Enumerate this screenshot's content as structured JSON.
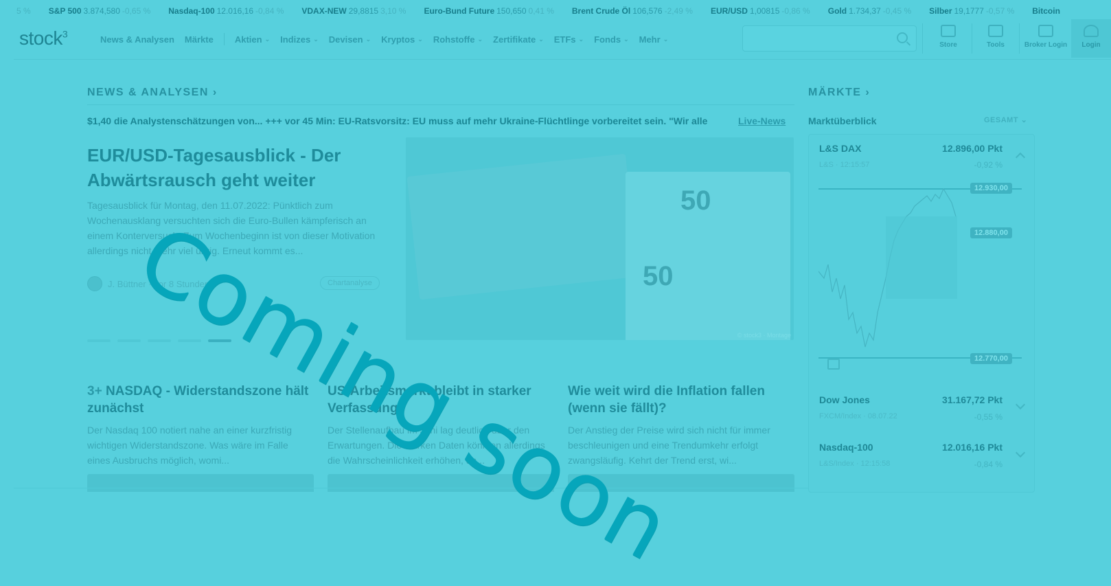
{
  "ticker": [
    {
      "name": "",
      "value": "",
      "change": "5 %"
    },
    {
      "name": "S&P 500",
      "value": "3.874,580",
      "change": "-0,65 %"
    },
    {
      "name": "Nasdaq-100",
      "value": "12.016,16",
      "change": "-0,84 %"
    },
    {
      "name": "VDAX-NEW",
      "value": "29,8815",
      "change": "3,10 %"
    },
    {
      "name": "Euro-Bund Future",
      "value": "150,650",
      "change": "0,41 %"
    },
    {
      "name": "Brent Crude Öl",
      "value": "106,576",
      "change": "-2,49 %"
    },
    {
      "name": "EUR/USD",
      "value": "1,00815",
      "change": "-0,86 %"
    },
    {
      "name": "Gold",
      "value": "1.734,37",
      "change": "-0,45 %"
    },
    {
      "name": "Silber",
      "value": "19,1777",
      "change": "-0,57 %"
    },
    {
      "name": "Bitcoin",
      "value": "",
      "change": ""
    }
  ],
  "header": {
    "logo": "stock",
    "logo_sup": "3",
    "nav": [
      {
        "label": "News & Analysen",
        "has_menu": false
      },
      {
        "label": "Märkte",
        "has_menu": false
      },
      {
        "label": "Aktien",
        "has_menu": true
      },
      {
        "label": "Indizes",
        "has_menu": true
      },
      {
        "label": "Devisen",
        "has_menu": true
      },
      {
        "label": "Kryptos",
        "has_menu": true
      },
      {
        "label": "Rohstoffe",
        "has_menu": true
      },
      {
        "label": "Zertifikate",
        "has_menu": true
      },
      {
        "label": "ETFs",
        "has_menu": true
      },
      {
        "label": "Fonds",
        "has_menu": true
      },
      {
        "label": "Mehr",
        "has_menu": true
      }
    ],
    "buttons": {
      "store": "Store",
      "tools": "Tools",
      "broker": "Broker Login",
      "login": "Login"
    }
  },
  "news": {
    "section_title": "NEWS & ANALYSEN",
    "ticker_line": "$1,40 die Analystenschätzungen von... +++ vor 45 Min: EU-Ratsvorsitz: EU muss auf mehr Ukraine-Flüchtlinge vorbereitet sein. \"Wir alle",
    "live_label": "Live-News",
    "hero": {
      "title": "EUR/USD-Tagesausblick - Der Abwärtsrausch geht weiter",
      "text": "Tagesausblick für Montag, den 11.07.2022: Pünktlich zum Wochenausklang versuchten sich die Euro-Bullen kämpferisch an einem Konterversuch. Zum Wochenbeginn ist von dieser Motivation allerdings nicht mehr viel übrig. Erneut kommt es...",
      "author": "J. Büttner · vor 8 Stunden",
      "tag": "Chartanalyse",
      "img_num_left": "50",
      "img_num_right": "50",
      "caption": "© stock3 · Montage"
    },
    "cards": [
      {
        "num": "3+",
        "title": "NASDAQ - Widerstandszone hält zunächst",
        "text": "Der Nasdaq 100 notiert nahe an einer kurzfristig wichtigen Widerstandszone. Was wäre im Falle eines Ausbruchs möglich, womi..."
      },
      {
        "num": "",
        "title": "US-Arbeitsmarkt bleibt in starker Verfassung",
        "text": "Der Stellenaufbau im Juni lag deutlich über den Erwartungen. Die starken Daten könnten allerdings die Wahrscheinlichkeit erhöhen, da..."
      },
      {
        "num": "",
        "title": "Wie weit wird die Inflation fallen (wenn sie fällt)?",
        "text": "Der Anstieg der Preise wird sich nicht für immer beschleunigen und eine Trendumkehr erfolgt zwangsläufig. Kehrt der Trend erst, wi..."
      }
    ]
  },
  "markets": {
    "section_title": "MÄRKTE",
    "sub_title": "Marktüberblick",
    "filter": "GESAMT",
    "rows": [
      {
        "name": "L&S DAX",
        "value": "12.896,00 Pkt",
        "change": "-0,92 %",
        "time": "L&S · 12:15:57"
      },
      {
        "name": "Dow Jones",
        "value": "31.167,72 Pkt",
        "change": "-0,55 %",
        "time": "FXCM/Index · 08.07.22"
      },
      {
        "name": "Nasdaq-100",
        "value": "12.016,16 Pkt",
        "change": "-0,84 %",
        "time": "L&S/Index · 12:15:58"
      }
    ],
    "chart_badges": [
      "12.930,00",
      "12.880,00",
      "12.770,00"
    ]
  },
  "overlay": "Coming soon",
  "colors": {
    "background": "#57d0dd",
    "overlay": "#06a6bb"
  }
}
